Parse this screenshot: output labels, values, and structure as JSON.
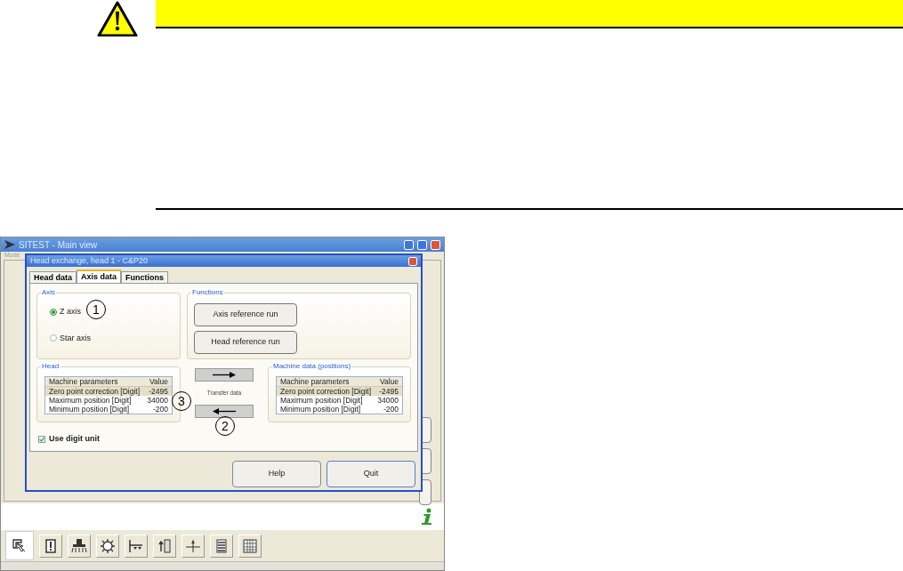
{
  "main_window": {
    "title": "SITEST - Main view",
    "menu": [
      "Mode"
    ],
    "toolbar": [
      {
        "kind": "pointer",
        "selected": true
      },
      {
        "kind": "card",
        "selected": false
      },
      {
        "kind": "head",
        "selected": false
      },
      {
        "kind": "gear",
        "selected": false
      },
      {
        "kind": "conveyor",
        "selected": false
      },
      {
        "kind": "axis-up",
        "selected": false
      },
      {
        "kind": "axis-center",
        "selected": false
      },
      {
        "kind": "list",
        "selected": false
      },
      {
        "kind": "grid",
        "selected": false
      }
    ]
  },
  "dialog": {
    "title": "Head exchange, head 1 - C&P20",
    "tabs": [
      {
        "label": "Head data",
        "selected": false
      },
      {
        "label": "Axis data",
        "selected": true
      },
      {
        "label": "Functions",
        "selected": false
      }
    ],
    "axis_group": {
      "title": "Axis",
      "options": [
        {
          "label": "Z axis",
          "selected": true
        },
        {
          "label": "Star axis",
          "selected": false
        }
      ]
    },
    "functions_group": {
      "title": "Functions",
      "buttons": [
        "Axis reference run",
        "Head reference run"
      ]
    },
    "head_group": {
      "title": "Head",
      "columns": [
        "Machine parameters",
        "Value"
      ],
      "rows": [
        {
          "cells": [
            "Zero point correction [Digit]",
            "-2495"
          ],
          "selected": true
        },
        {
          "cells": [
            "Maximum position [Digit]",
            "34000"
          ],
          "selected": false
        },
        {
          "cells": [
            "Minimum position [Digit]",
            "-200"
          ],
          "selected": false
        }
      ]
    },
    "transfer": {
      "label": "Transfer data"
    },
    "machine_group": {
      "title": "Machine data (positions)",
      "columns": [
        "Machine parameters",
        "Value"
      ],
      "rows": [
        {
          "cells": [
            "Zero point correction [Digit]",
            "-2495"
          ],
          "selected": true
        },
        {
          "cells": [
            "Maximum position [Digit]",
            "34000"
          ],
          "selected": false
        },
        {
          "cells": [
            "Minimum position [Digit]",
            "-200"
          ],
          "selected": false
        }
      ]
    },
    "use_digit_unit": {
      "label": "Use digit unit",
      "checked": true
    },
    "buttons": [
      "Help",
      "Quit"
    ]
  },
  "callouts": [
    "1",
    "2",
    "3"
  ]
}
